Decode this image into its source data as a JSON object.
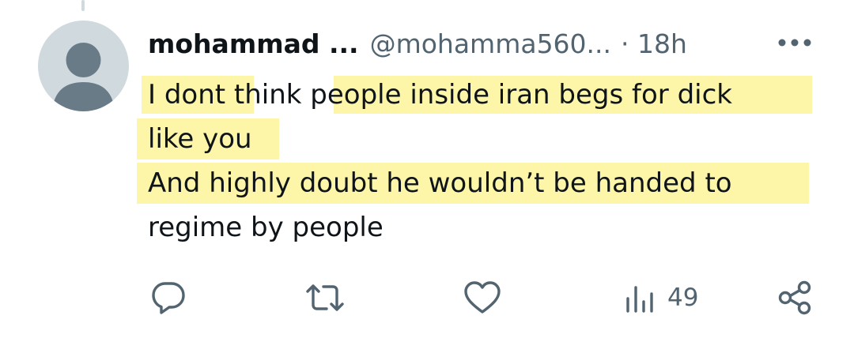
{
  "tweet": {
    "display_name": "mohammad ...",
    "handle": "@mohamma560...",
    "timestamp": "· 18h",
    "more_icon": "more-horizontal-icon",
    "lines": [
      "I dont think people inside iran begs for dick",
      "like you",
      "And highly doubt he wouldn’t be handed to",
      "regime by people"
    ],
    "highlight_color": "#fdf59a"
  },
  "actions": {
    "reply_icon": "reply-bubble-icon",
    "retweet_icon": "retweet-icon",
    "like_icon": "heart-icon",
    "views_icon": "views-bar-chart-icon",
    "views_count": "49",
    "share_icon": "share-nodes-icon"
  },
  "colors": {
    "text": "#0f1419",
    "secondary": "#536471",
    "avatar_bg": "#cfd9de",
    "avatar_fg": "#6a7b88"
  }
}
